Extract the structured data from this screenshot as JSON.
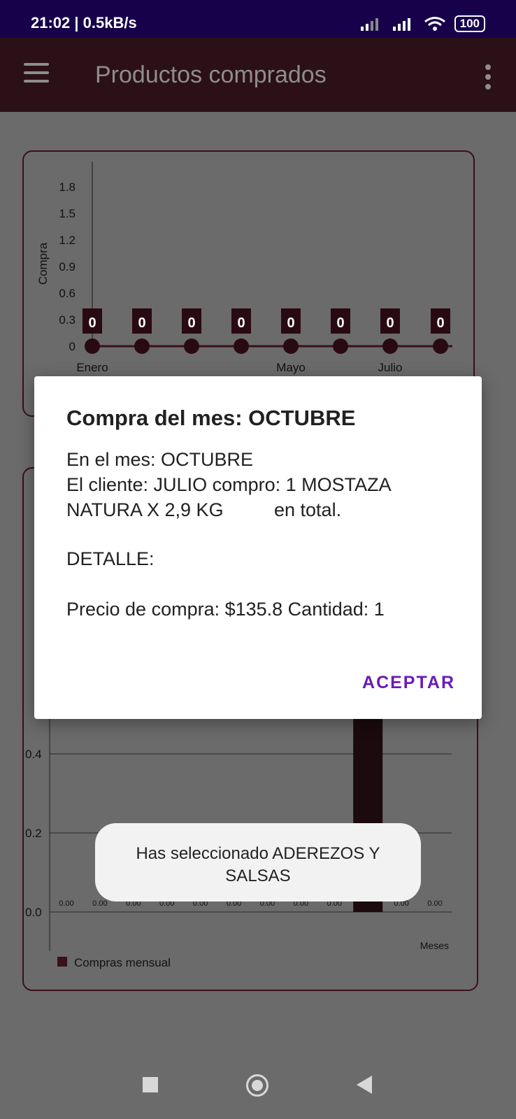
{
  "status": {
    "time": "21:02 | 0.5kB/s",
    "battery": "100"
  },
  "appbar": {
    "title": "Productos comprados"
  },
  "chart_data": [
    {
      "type": "line",
      "ylabel": "Compra",
      "yticks": [
        "1.8",
        "1.5",
        "1.2",
        "0.9",
        "0.6",
        "0.3",
        "0"
      ],
      "ylim": [
        0,
        1.8
      ],
      "x": [
        "Enero",
        "",
        "",
        "",
        "Mayo",
        "",
        "Julio",
        ""
      ],
      "values": [
        0,
        0,
        0,
        0,
        0,
        0,
        0,
        0
      ],
      "data_labels": [
        "0",
        "0",
        "0",
        "0",
        "0",
        "0",
        "0",
        "0"
      ],
      "color": "#3a1019"
    },
    {
      "type": "bar",
      "xlabel": "Meses",
      "yticks": [
        "0.0",
        "0.2",
        "0.4"
      ],
      "ylim": [
        0,
        1.0
      ],
      "values": [
        0,
        0,
        0,
        0,
        0,
        0,
        0,
        0,
        0,
        1,
        0,
        0
      ],
      "data_labels": [
        "0.00",
        "0.00",
        "0.00",
        "0.00",
        "0.00",
        "0.00",
        "0.00",
        "0.00",
        "0.00",
        "",
        "0.00",
        "0.00"
      ],
      "legend": "Compras mensual",
      "color": "#1b0a0e"
    }
  ],
  "dialog": {
    "title": "Compra del mes: OCTUBRE",
    "line1": "En el mes: OCTUBRE",
    "line2": "El cliente: JULIO compro: 1 MOSTAZA",
    "line3": "NATURA X 2,9 KG",
    "line3b": "en total.",
    "line4": "DETALLE:",
    "line5": "Precio de compra: $135.8 Cantidad: 1",
    "accept": "ACEPTAR"
  },
  "toast": {
    "line1": "Has seleccionado ADEREZOS Y",
    "line2": "SALSAS"
  }
}
